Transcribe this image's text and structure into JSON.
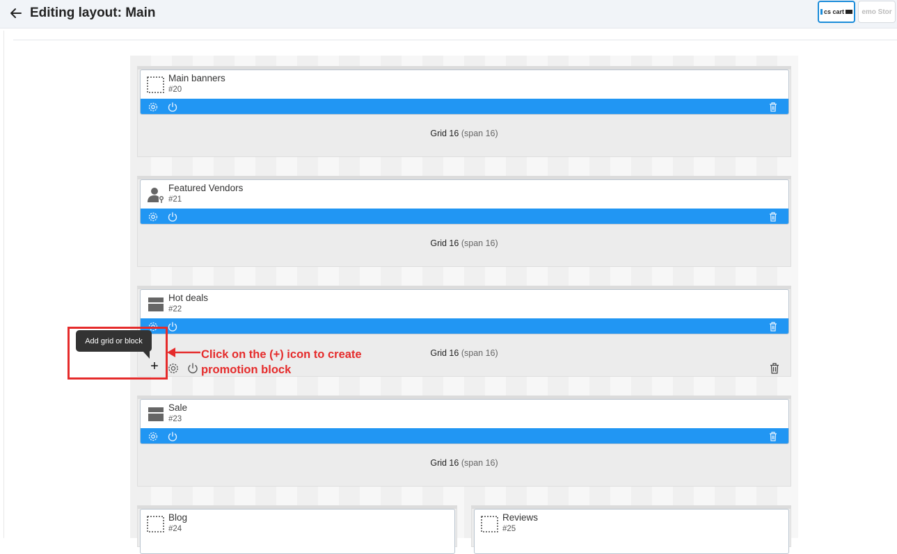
{
  "header": {
    "title": "Editing layout: Main",
    "thumbs": [
      {
        "label": "cs cart",
        "active": true
      },
      {
        "label": "emo Stor",
        "active": false
      }
    ]
  },
  "icons": {
    "back": "arrow-left-icon",
    "settings": "gear-icon",
    "power": "power-icon",
    "delete": "trash-icon",
    "add": "plus-icon"
  },
  "colors": {
    "accent": "#2196f3",
    "annotation": "#e52b2b"
  },
  "containers": [
    {
      "grid_label": "Grid 16",
      "grid_span": "(span 16)",
      "block": {
        "name": "Main banners",
        "id": "#20",
        "icon": "placeholder-icon"
      }
    },
    {
      "grid_label": "Grid 16",
      "grid_span": "(span 16)",
      "block": {
        "name": "Featured Vendors",
        "id": "#21",
        "icon": "vendor-icon"
      }
    },
    {
      "grid_label": "Grid 16",
      "grid_span": "(span 16)",
      "block": {
        "name": "Hot deals",
        "id": "#22",
        "icon": "box-icon"
      }
    },
    {
      "grid_label": "Grid 16",
      "grid_span": "(span 16)",
      "block": {
        "name": "Sale",
        "id": "#23",
        "icon": "box-icon"
      }
    },
    {
      "block": {
        "name": "Blog",
        "id": "#24",
        "icon": "placeholder-icon"
      }
    },
    {
      "block": {
        "name": "Reviews",
        "id": "#25",
        "icon": "placeholder-icon"
      }
    }
  ],
  "tooltip": {
    "text": "Add grid or block"
  },
  "add_button": {
    "symbol": "+"
  },
  "annotation": {
    "line1": "Click on the (+) icon to create",
    "line2": "promotion block"
  }
}
